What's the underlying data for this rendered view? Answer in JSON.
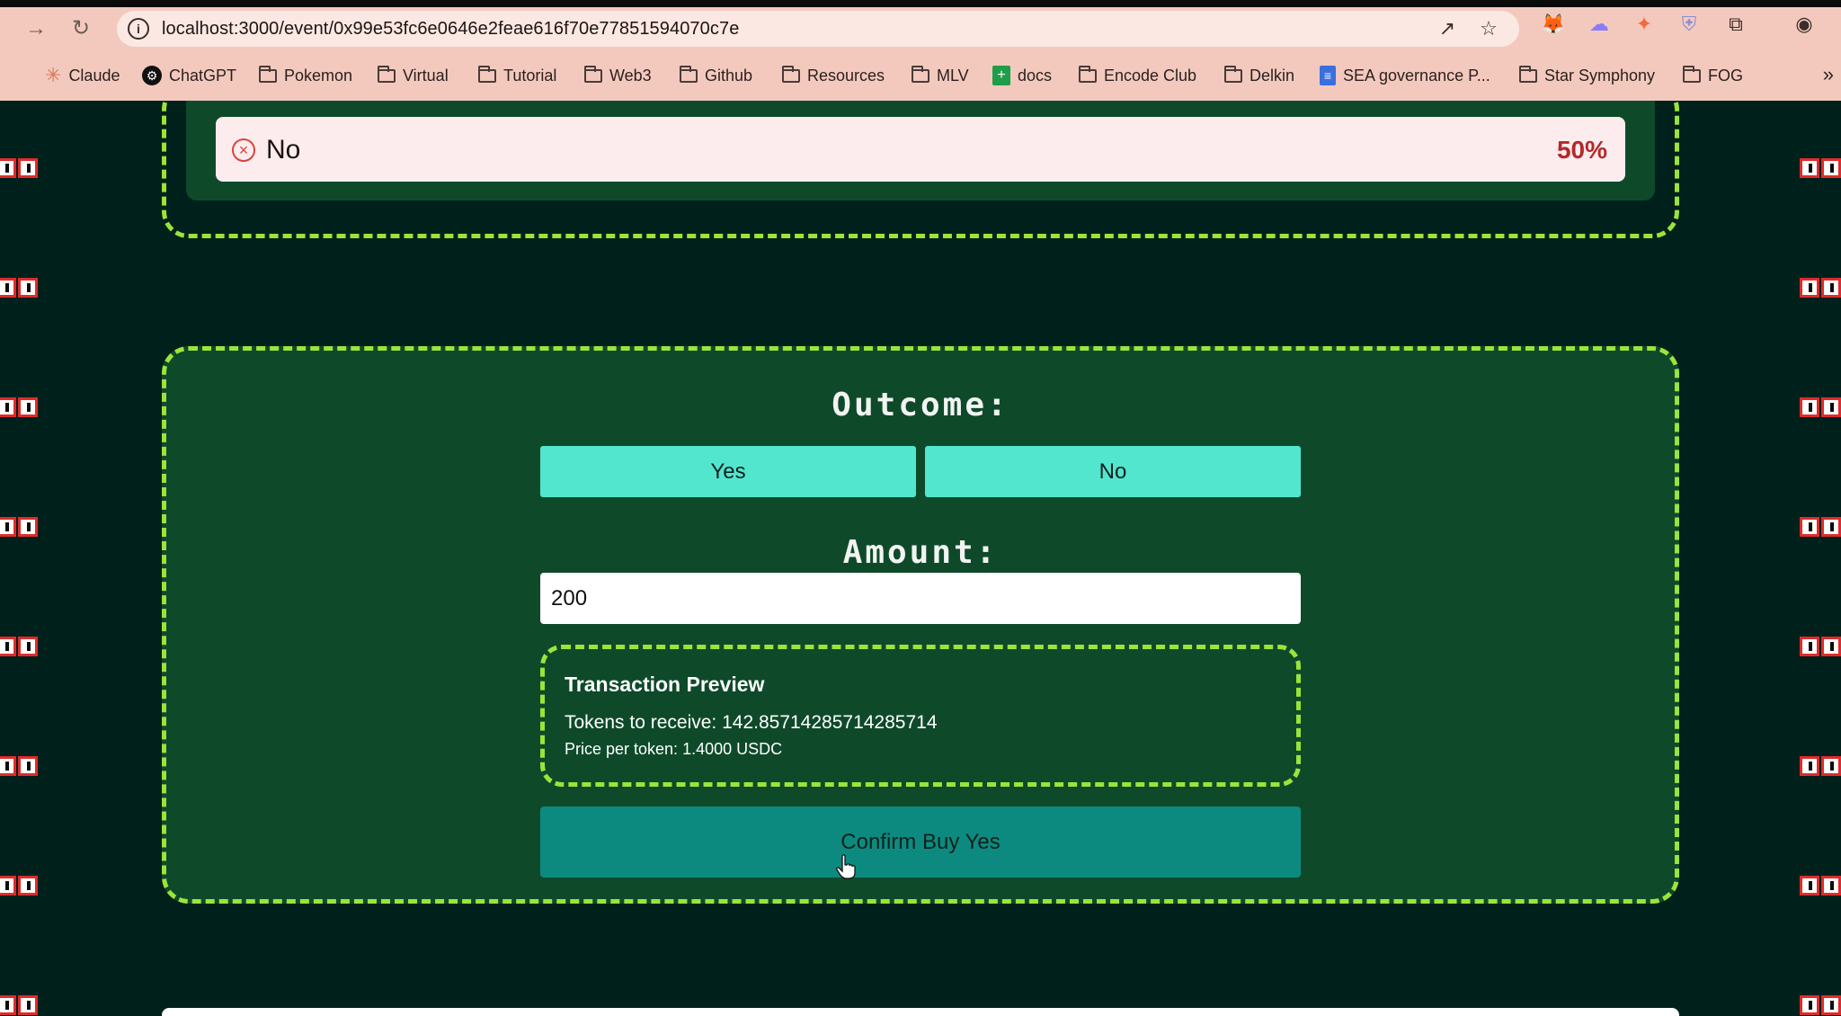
{
  "browser": {
    "url": "localhost:3000/event/0x99e53fc6e0646e2feae616f70e77851594070c7e",
    "bookmarks": [
      {
        "label": "Claude",
        "icon": "claude-icon"
      },
      {
        "label": "ChatGPT",
        "icon": "chatgpt-icon"
      },
      {
        "label": "Pokemon",
        "icon": "folder-icon"
      },
      {
        "label": "Virtual",
        "icon": "folder-icon"
      },
      {
        "label": "Tutorial",
        "icon": "folder-icon"
      },
      {
        "label": "Web3",
        "icon": "folder-icon"
      },
      {
        "label": "Github",
        "icon": "folder-icon"
      },
      {
        "label": "Resources",
        "icon": "folder-icon"
      },
      {
        "label": "MLV",
        "icon": "folder-icon"
      },
      {
        "label": "docs",
        "icon": "sheets-icon"
      },
      {
        "label": "Encode Club",
        "icon": "folder-icon"
      },
      {
        "label": "Delkin",
        "icon": "folder-icon"
      },
      {
        "label": "SEA governance P...",
        "icon": "docs-icon"
      },
      {
        "label": "Star Symphony",
        "icon": "folder-icon"
      },
      {
        "label": "FOG",
        "icon": "folder-icon"
      }
    ]
  },
  "outcome_row": {
    "label": "No",
    "percent": "50%"
  },
  "trade": {
    "outcome_heading": "Outcome:",
    "options": [
      "Yes",
      "No"
    ],
    "amount_heading": "Amount:",
    "amount_value": "200",
    "preview": {
      "title": "Transaction Preview",
      "tokens": "Tokens to receive: 142.85714285714285714",
      "price": "Price per token: 1.4000 USDC"
    },
    "confirm_label": "Confirm Buy Yes"
  },
  "colors": {
    "page_bg": "#00201b",
    "panel_bg": "#0e4a2a",
    "dashed_border": "#9be43a",
    "option_button": "#52e6cf",
    "confirm_button": "#0d8a7f",
    "chrome_bg": "#f3c9be"
  }
}
